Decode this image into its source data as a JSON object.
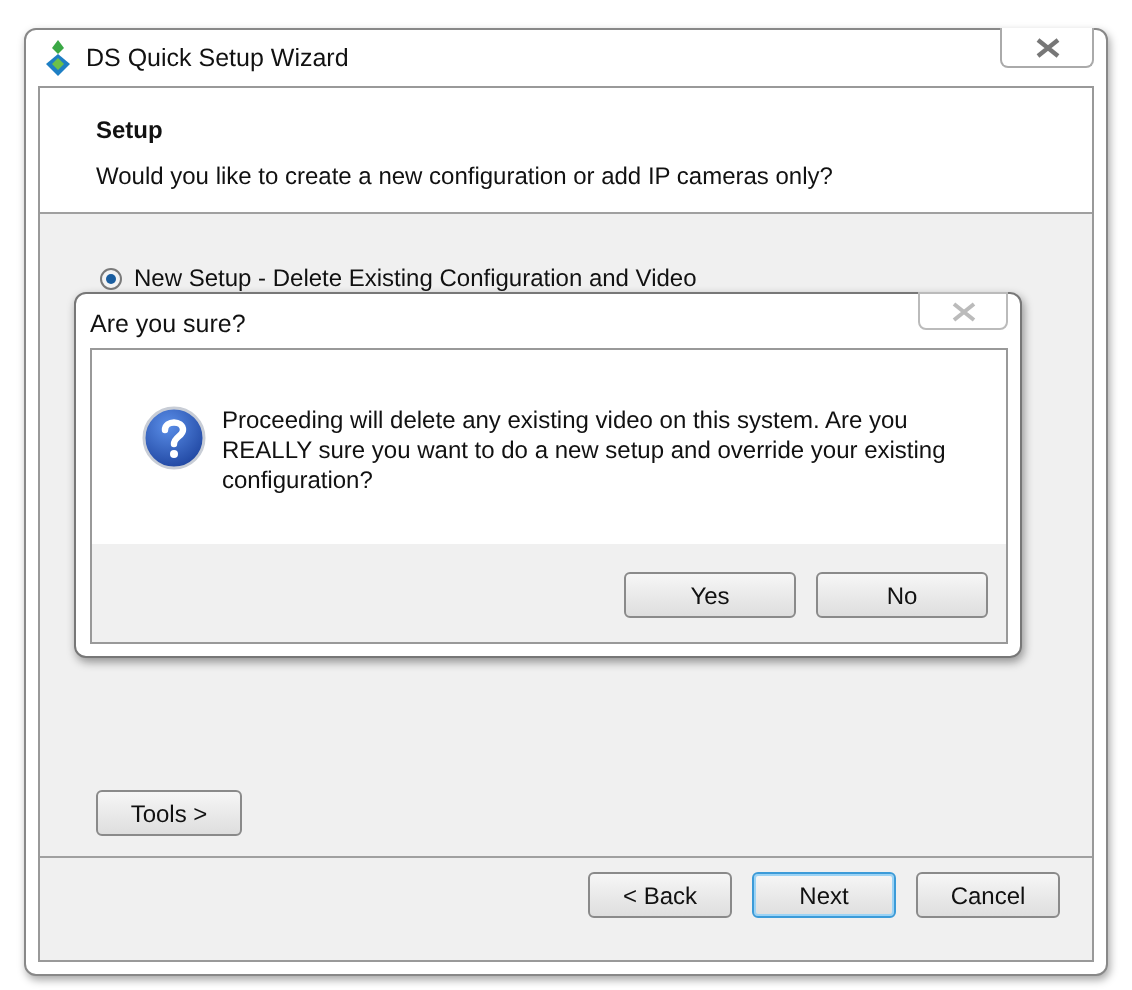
{
  "window": {
    "title": "DS Quick Setup Wizard"
  },
  "header": {
    "title": "Setup",
    "subtitle": "Would you like to create a new configuration or add IP cameras only?"
  },
  "options": [
    {
      "label": "New Setup - Delete Existing Configuration and Video",
      "selected": true
    }
  ],
  "tools_button": "Tools >",
  "buttons": [
    {
      "label": "< Back",
      "default": false
    },
    {
      "label": "Next",
      "default": true
    },
    {
      "label": "Cancel",
      "default": false
    }
  ],
  "dialog": {
    "title": "Are you sure?",
    "message": "Proceeding will delete any existing video on this system. Are you REALLY sure you want to do a new setup and override your existing configuration?",
    "buttons": [
      "Yes",
      "No"
    ]
  }
}
